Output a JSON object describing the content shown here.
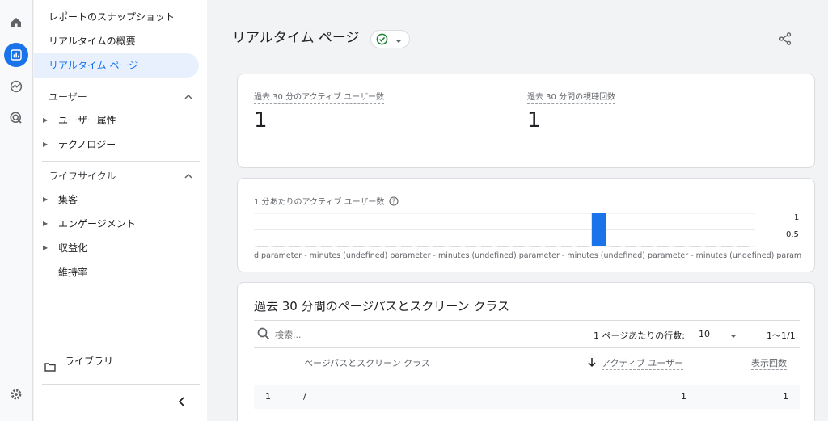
{
  "rail": {
    "items": [
      {
        "icon": "home-icon"
      },
      {
        "icon": "reports-icon",
        "active": true
      },
      {
        "icon": "explore-icon"
      },
      {
        "icon": "advertising-icon"
      }
    ],
    "settings_icon": "gear-icon"
  },
  "nav": {
    "items": [
      "レポートのスナップショット",
      "リアルタイムの概要",
      "リアルタイム ページ"
    ],
    "section_user": "ユーザー",
    "user_items": [
      "ユーザー属性",
      "テクノロジー"
    ],
    "section_lifecycle": "ライフサイクル",
    "lifecycle_items": [
      "集客",
      "エンゲージメント",
      "収益化",
      "維持率"
    ],
    "library": "ライブラリ",
    "collapse_icon": "chevron-left-icon"
  },
  "header": {
    "title": "リアルタイム ページ",
    "status_icon": "check-circle-icon",
    "share_icon": "share-icon"
  },
  "metrics": [
    {
      "label": "過去 30 分のアクティブ ユーザー数",
      "value": "1"
    },
    {
      "label": "過去 30 分間の視聴回数",
      "value": "1"
    }
  ],
  "chart": {
    "label": "1 分あたりのアクティブ ユーザー数",
    "help_icon": "help-icon",
    "xaxis_text": "d parameter - minutes (undefined) parameter - minutes (undefined) parameter - minutes (undefined) parameter - minutes (undefined) parameter - minutes (undefined) parameter - minutes (undefined) parameter - minutes",
    "ytick_top": "1",
    "ytick_mid": "0.5",
    "accent": "#1a73e8"
  },
  "chart_data": {
    "type": "bar",
    "title": "1 分あたりのアクティブ ユーザー数",
    "values": [
      0,
      0,
      0,
      0,
      0,
      0,
      0,
      0,
      0,
      0,
      0,
      0,
      0,
      0,
      0,
      0,
      0,
      0,
      0,
      0,
      0,
      1,
      0,
      0,
      0,
      0,
      0,
      0,
      0,
      0,
      0
    ],
    "ylim": [
      0,
      1
    ],
    "yticks": [
      "1",
      "0.5"
    ],
    "grid": true
  },
  "table": {
    "title": "過去 30 分間のページパスとスクリーン クラス",
    "search_placeholder": "検索...",
    "rows_per_page_label": "1 ページあたりの行数:",
    "rows_per_page_value": "10",
    "pagination": "1〜1/1",
    "columns": [
      "ページパスとスクリーン クラス",
      "アクティブ ユーザー",
      "表示回数"
    ],
    "rows": [
      {
        "index": "1",
        "path": "/",
        "active_users": "1",
        "views": "1"
      }
    ]
  }
}
